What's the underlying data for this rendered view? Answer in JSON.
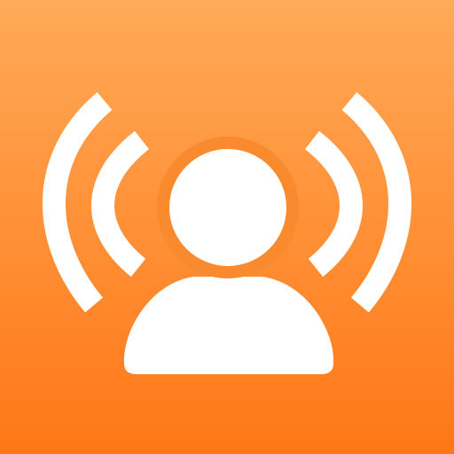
{
  "icon": {
    "name": "user-broadcast-icon",
    "gradient_top": "#FFAA58",
    "gradient_bottom": "#FF7716",
    "glyph_color": "#FFFFFF",
    "ring_color": "#F98A2E"
  }
}
